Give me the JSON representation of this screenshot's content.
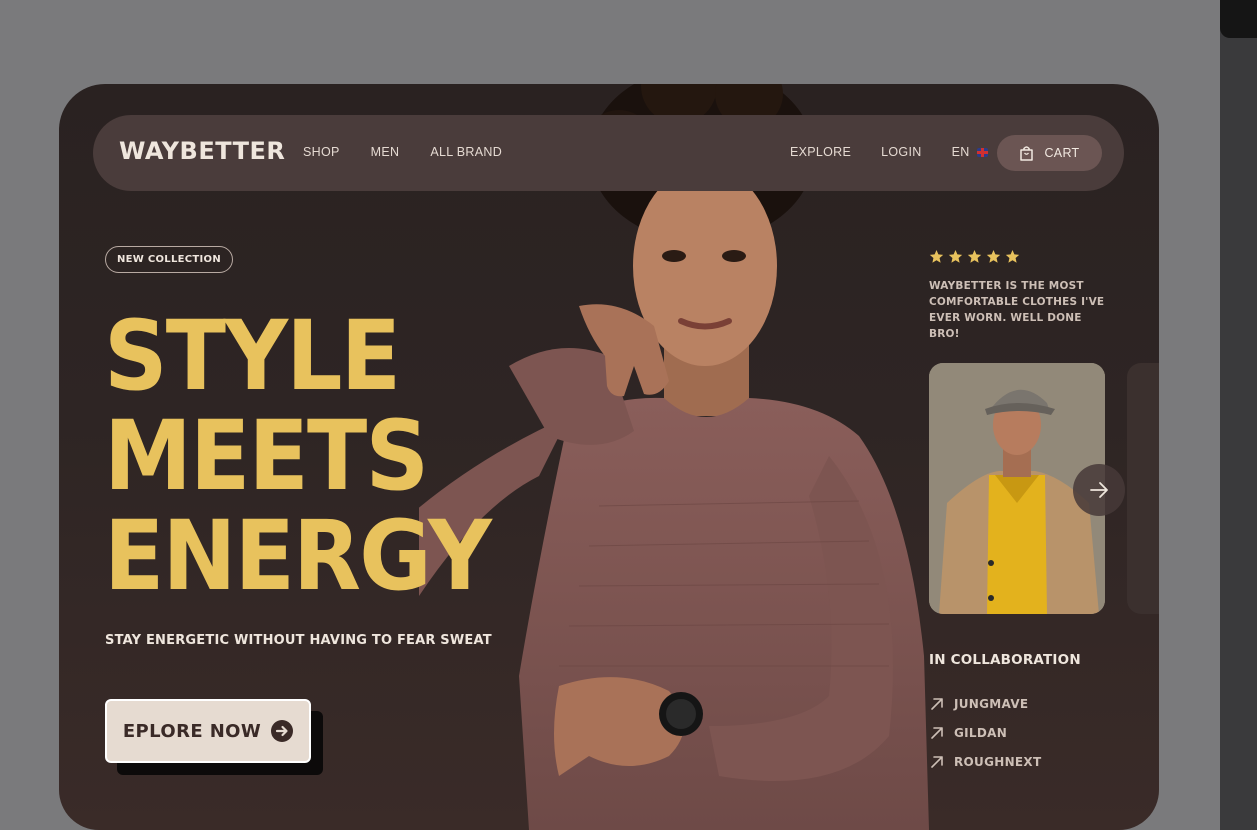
{
  "nav": {
    "logo": "WAYBETTER",
    "left_links": [
      "SHOP",
      "MEN",
      "ALL BRAND"
    ],
    "right_links": [
      "EXPLORE",
      "LOGIN"
    ],
    "language": "EN",
    "cart_label": "CART"
  },
  "hero": {
    "badge": "NEW COLLECTION",
    "headline_lines": [
      "STYLE",
      "MEETS",
      "ENERGY"
    ],
    "subline": "STAY ENERGETIC WITHOUT HAVING TO FEAR SWEAT",
    "cta_label": "EPLORE NOW"
  },
  "review": {
    "rating": 5,
    "max_rating": 5,
    "quote": "WAYBETTER IS THE MOST COMFORTABLE CLOTHES I'VE EVER WORN. WELL DONE BRO!"
  },
  "collaboration": {
    "title": "IN COLLABORATION",
    "brands": [
      "JUNGMAVE",
      "GILDAN",
      "ROUGHNEXT"
    ]
  },
  "colors": {
    "accent": "#e8c25d",
    "card_bg": "#2a2221",
    "nav_bg": "#4a3c3b",
    "cta_bg": "#e6dbd1"
  },
  "icons": {
    "cart": "shopping-bag-icon",
    "cta": "arrow-right-circle-icon",
    "carousel_next": "arrow-right-icon",
    "collab": "arrow-up-right-icon",
    "rating": "star-icon"
  }
}
